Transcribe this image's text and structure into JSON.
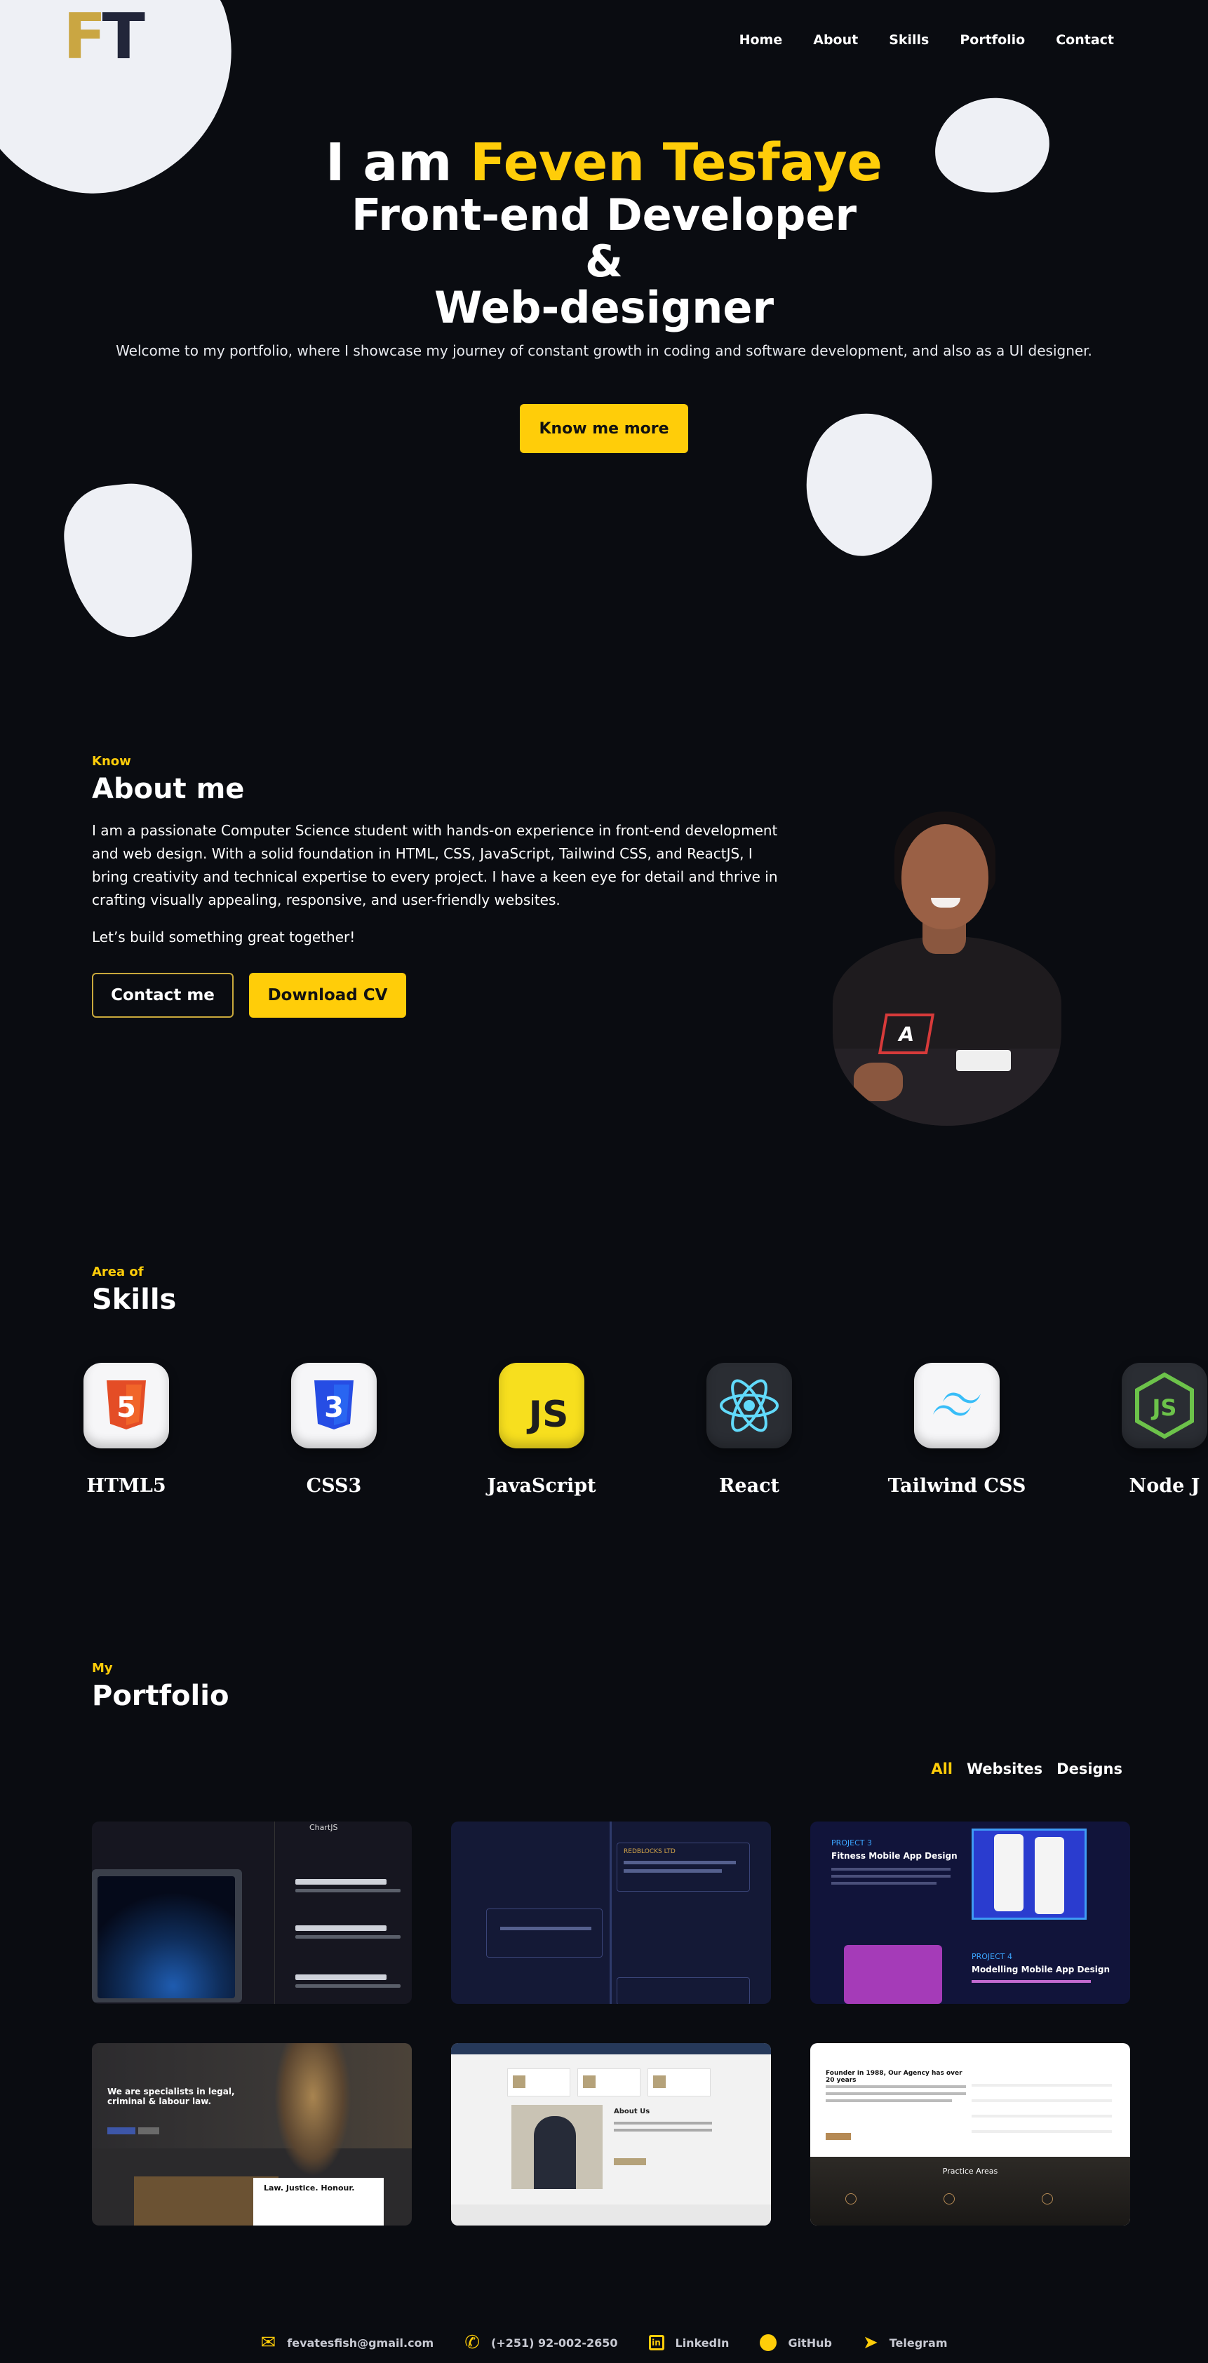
{
  "header": {
    "logo": "FT",
    "nav": [
      "Home",
      "About",
      "Skills",
      "Portfolio",
      "Contact"
    ]
  },
  "hero": {
    "intro": "I am",
    "name": "Feven Tesfaye",
    "role_line1": "Front-end Developer",
    "role_amp": "&",
    "role_line2": "Web-designer",
    "description": "Welcome to my portfolio, where I showcase my journey of constant growth in coding and software development, and also as a UI designer.",
    "cta": "Know me more"
  },
  "about": {
    "kicker": "Know",
    "title": "About me",
    "paragraph": "I am a passionate Computer Science student with hands-on experience in front-end development and web design. With a solid foundation in HTML, CSS, JavaScript, Tailwind CSS, and ReactJS, I bring creativity and technical expertise to every project. I have a keen eye for detail and thrive in crafting visually appealing, responsive, and user-friendly websites.",
    "closing": "Let’s build something great together!",
    "contact_button": "Contact me",
    "download_button": "Download CV"
  },
  "skills": {
    "kicker": "Area of",
    "title": "Skills",
    "items": [
      {
        "name": "HTML5",
        "icon": "html5-icon",
        "label": "5",
        "bg": "#f6f6f8",
        "fg": "#e44d26"
      },
      {
        "name": "CSS3",
        "icon": "css3-icon",
        "label": "3",
        "bg": "#f6f6f8",
        "fg": "#264de4"
      },
      {
        "name": "JavaScript",
        "icon": "javascript-icon",
        "label": "JS",
        "bg": "#f7df1e",
        "fg": "#1e1e1e"
      },
      {
        "name": "React",
        "icon": "react-icon",
        "label": "⚛",
        "bg": "#2a2d33",
        "fg": "#61dafb"
      },
      {
        "name": "Tailwind CSS",
        "icon": "tailwind-icon",
        "label": "≈",
        "bg": "#f6f6f8",
        "fg": "#38bdf8"
      },
      {
        "name": "Node J",
        "icon": "nodejs-icon",
        "label": "JS",
        "bg": "#2a2d33",
        "fg": "#6cc24a"
      }
    ]
  },
  "portfolio": {
    "kicker": "My",
    "title": "Portfolio",
    "filters": [
      "All",
      "Websites",
      "Designs"
    ],
    "cards": [
      {
        "name": "project-chartjs-card",
        "title": "ChartJS",
        "bg": "#161620"
      },
      {
        "name": "project-timeline-card",
        "title": "REDBLOCKS LTD",
        "bg": "#141936"
      },
      {
        "name": "project-mobile-app-card",
        "title": "PROJECT 3",
        "subtitle": "Fitness Mobile App Design",
        "title2": "PROJECT 4",
        "subtitle2": "Modelling Mobile App Design",
        "bg": "#11143a"
      },
      {
        "name": "project-law-card",
        "title": "We are specialists in legal, criminal & labour law.",
        "subtitle": "Law. Justice. Honour.",
        "bg": "#2b2a2c"
      },
      {
        "name": "project-lawyer-profile-card",
        "title": "About Us",
        "bg": "#f2f2f2"
      },
      {
        "name": "project-law-agency-card",
        "title": "Founder in 1988, Our Agency has over 20 years",
        "subtitle": "Practice Areas",
        "bg": "#ffffff"
      }
    ]
  },
  "contact": {
    "email": "fevatesfish@gmail.com",
    "phone": "(+251) 92-002-2650",
    "linkedin": "LinkedIn",
    "github": "GitHub",
    "telegram": "Telegram"
  }
}
